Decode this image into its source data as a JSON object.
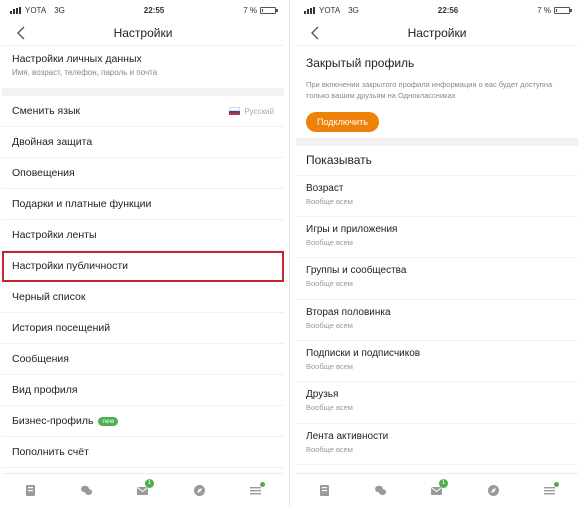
{
  "left": {
    "status": {
      "carrier": "YOTA",
      "network": "3G",
      "time": "22:55",
      "battery": "7 %"
    },
    "title": "Настройки",
    "personal": {
      "title": "Настройки личных данных",
      "subtitle": "Имя, возраст, телефон, пароль и почта"
    },
    "items": [
      {
        "label": "Сменить язык",
        "value": "Русский"
      },
      {
        "label": "Двойная защита"
      },
      {
        "label": "Оповещения"
      },
      {
        "label": "Подарки и платные функции"
      },
      {
        "label": "Настройки ленты"
      },
      {
        "label": "Настройки публичности"
      },
      {
        "label": "Черный список"
      },
      {
        "label": "История посещений"
      },
      {
        "label": "Сообщения"
      },
      {
        "label": "Вид профиля"
      },
      {
        "label": "Бизнес-профиль",
        "badge": "new"
      },
      {
        "label": "Пополнить счёт"
      }
    ]
  },
  "right": {
    "status": {
      "carrier": "YOTA",
      "network": "3G",
      "time": "22:56",
      "battery": "7 %"
    },
    "title": "Настройки",
    "private_profile": {
      "title": "Закрытый профиль",
      "description": "При включении закрытого профиля информация о вас будет доступна только вашим друзьям на Одноклассниках",
      "button": "Подключить"
    },
    "show_header": "Показывать",
    "items": [
      {
        "label": "Возраст",
        "value": "Вообще всем"
      },
      {
        "label": "Игры и приложения",
        "value": "Вообще всем"
      },
      {
        "label": "Группы и сообщества",
        "value": "Вообще всем"
      },
      {
        "label": "Вторая половинка",
        "value": "Вообще всем"
      },
      {
        "label": "Подписки и подписчиков",
        "value": "Вообще всем"
      },
      {
        "label": "Друзья",
        "value": "Вообще всем"
      },
      {
        "label": "Лента активности",
        "value": "Вообще всем"
      }
    ]
  },
  "tabbar": {
    "icons": [
      "feed-icon",
      "chat-bubbles-icon",
      "messages-icon",
      "discover-icon",
      "menu-icon"
    ],
    "messages_count": "1"
  },
  "battery_level": 0.07,
  "colors": {
    "accent_orange": "#ee8208",
    "badge_green": "#4cae4c",
    "highlight_red": "#c1272d"
  }
}
